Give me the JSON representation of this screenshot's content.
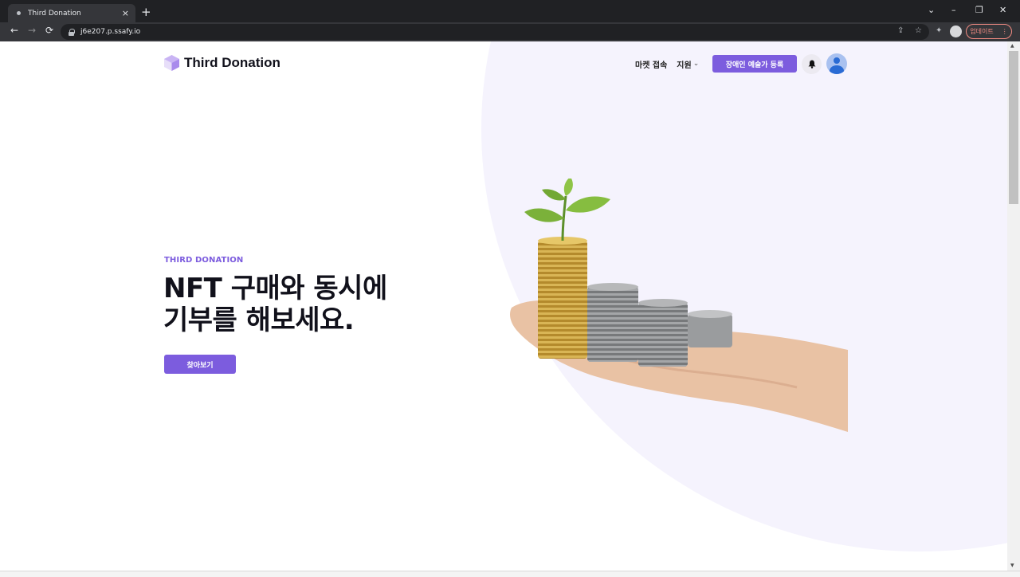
{
  "browser": {
    "tab_title": "Third Donation",
    "tab_close": "×",
    "new_tab": "+",
    "url": "j6e207.p.ssafy.io",
    "update_label": "업데이트",
    "menu_dots": "⋮",
    "window_controls": {
      "collapse": "⌄",
      "minimize": "–",
      "restore": "❐",
      "close": "✕"
    },
    "nav": {
      "back": "←",
      "forward": "→",
      "reload": "⟳"
    },
    "icons": {
      "share": "⇪",
      "star": "☆",
      "extensions": "✦"
    }
  },
  "header": {
    "logo_text": "Third Donation",
    "nav_market": "마켓 접속",
    "nav_support": "지원",
    "register_button": "장애인 예술가 등록"
  },
  "hero": {
    "eyebrow": "THIRD DONATION",
    "headline_line1": "NFT 구매와 동시에",
    "headline_line2": "기부를 해보세요.",
    "cta_label": "찾아보기"
  },
  "colors": {
    "accent": "#7c5cde",
    "background_shape": "#f5f3fd",
    "text_dark": "#11111b",
    "browser_dark": "#202124",
    "browser_toolbar": "#35363a",
    "update_red": "#f28b82"
  },
  "icons": [
    "hexagon-logo-icon",
    "bell-icon",
    "user-avatar-icon",
    "chevron-down-icon",
    "lock-icon",
    "profile-icon"
  ]
}
